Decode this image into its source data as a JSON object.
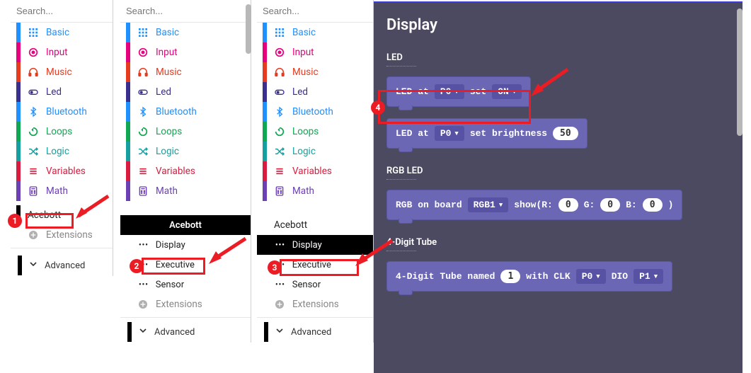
{
  "search": {
    "placeholder": "Search..."
  },
  "categories": {
    "basic": {
      "label": "Basic",
      "color": "#1e90ff",
      "txt": "#1e90ff"
    },
    "input": {
      "label": "Input",
      "color": "#e6007e",
      "txt": "#e6007e"
    },
    "music": {
      "label": "Music",
      "color": "#e63b1f",
      "txt": "#e63b1f"
    },
    "led": {
      "label": "Led",
      "color": "#3a2f8f",
      "txt": "#3a2f8f"
    },
    "bluetooth": {
      "label": "Bluetooth",
      "color": "#1e90ff",
      "txt": "#1e90ff"
    },
    "loops": {
      "label": "Loops",
      "color": "#0fa751",
      "txt": "#0fa751"
    },
    "logic": {
      "label": "Logic",
      "color": "#14a0a0",
      "txt": "#14a0a0"
    },
    "variables": {
      "label": "Variables",
      "color": "#d81b3e",
      "txt": "#d81b3e"
    },
    "math": {
      "label": "Math",
      "color": "#6c3fb5",
      "txt": "#6c3fb5"
    }
  },
  "acebott": {
    "header": "Acebott",
    "plain": "Acebott",
    "subs": {
      "display": "Display",
      "executive": "Executive",
      "sensor": "Sensor"
    }
  },
  "extensions": "Extensions",
  "advanced": "Advanced",
  "workspace": {
    "title": "Display",
    "sections": {
      "led": "LED",
      "rgb": "RGB LED",
      "tube": "4-Digit Tube"
    },
    "blocks": {
      "led_at": {
        "t1": "LED at",
        "pin": "P0",
        "t2": "set",
        "state": "ON"
      },
      "led_bright": {
        "t1": "LED at",
        "pin": "P0",
        "t2": "set brightness",
        "val": "50"
      },
      "rgb": {
        "t1": "RGB on board",
        "slot": "RGB1",
        "t2": "show(R:",
        "r": "0",
        "t3": "G:",
        "g": "0",
        "t4": "B:",
        "b": "0",
        "t5": ")"
      },
      "tube": {
        "t1": "4-Digit Tube named",
        "name": "1",
        "t2": "with CLK",
        "clk": "P0",
        "t3": "DIO",
        "dio": "P1"
      }
    }
  },
  "callouts": {
    "1": "1",
    "2": "2",
    "3": "3",
    "4": "4"
  }
}
